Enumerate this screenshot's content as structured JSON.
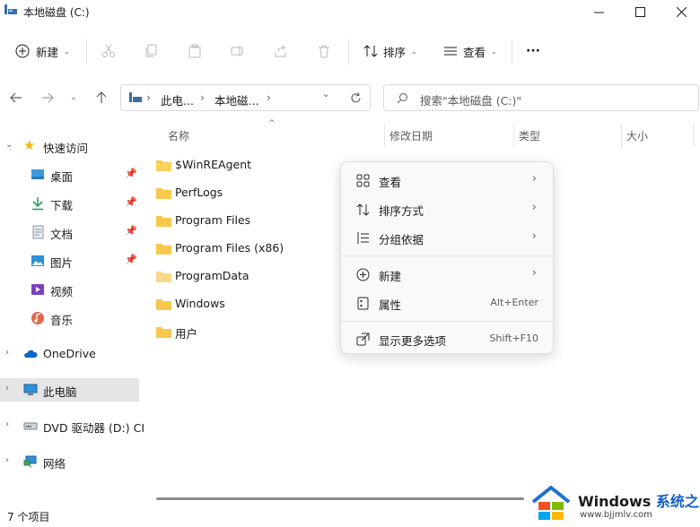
{
  "window": {
    "title": "本地磁盘 (C:)"
  },
  "toolbar": {
    "new_label": "新建",
    "sort_label": "排序",
    "view_label": "查看",
    "more_label": "···"
  },
  "nav": {
    "breadcrumb": [
      "此电...",
      "本地磁...",
      "›"
    ],
    "search_placeholder": "搜索\"本地磁盘 (C:)\""
  },
  "sidebar": {
    "items": [
      {
        "label": "快速访问",
        "icon": "star-icon"
      },
      {
        "label": "桌面",
        "icon": "desktop-icon",
        "pinned": true
      },
      {
        "label": "下载",
        "icon": "download-icon",
        "pinned": true
      },
      {
        "label": "文档",
        "icon": "document-icon",
        "pinned": true
      },
      {
        "label": "图片",
        "icon": "picture-icon",
        "pinned": true
      },
      {
        "label": "视频",
        "icon": "video-icon"
      },
      {
        "label": "音乐",
        "icon": "music-icon"
      },
      {
        "label": "OneDrive",
        "icon": "cloud-icon"
      },
      {
        "label": "此电脑",
        "icon": "computer-icon",
        "selected": true
      },
      {
        "label": "DVD 驱动器 (D:) CI",
        "icon": "dvd-icon"
      },
      {
        "label": "网络",
        "icon": "network-icon"
      }
    ]
  },
  "columns": [
    "名称",
    "修改日期",
    "类型",
    "大小"
  ],
  "files": [
    "$WinREAgent",
    "PerfLogs",
    "Program Files",
    "Program Files (x86)",
    "ProgramData",
    "Windows",
    "用户"
  ],
  "context_menu": {
    "items": [
      {
        "label": "查看",
        "icon": "grid-icon",
        "submenu": true
      },
      {
        "label": "排序方式",
        "icon": "sort-icon",
        "submenu": true
      },
      {
        "label": "分组依据",
        "icon": "group-icon",
        "submenu": true
      },
      {
        "label": "新建",
        "icon": "plus-circle-icon",
        "submenu": true
      },
      {
        "label": "属性",
        "icon": "properties-icon",
        "shortcut": "Alt+Enter"
      },
      {
        "label": "显示更多选项",
        "icon": "expand-icon",
        "shortcut": "Shift+F10"
      }
    ]
  },
  "status": {
    "count": "7 个项目"
  },
  "watermark": {
    "text": "Windows",
    "brand": "系统之家",
    "url": "www.bjjmlv.com"
  },
  "colors": {
    "folder": "#f7c84c",
    "accent": "#0067c0",
    "selected_bg": "#e5e5e5"
  }
}
